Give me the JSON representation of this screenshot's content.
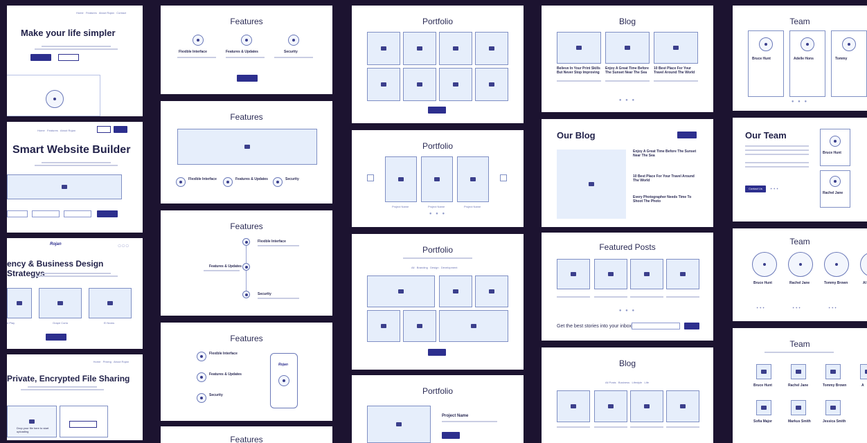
{
  "colors": {
    "background": "#1c1330",
    "card": "#ffffff",
    "accent": "#2d2f8e",
    "placeholder": "#e6eefb"
  },
  "hero": {
    "t1": "Make your life simpler",
    "t2": "Smart Website Builder",
    "t3": "ency & Business Design Strategys",
    "t4": "Private, Encrypted File Sharing",
    "logo": "Rojan",
    "c3_labels": [
      "n Play",
      "Grape Corla",
      "El Noms"
    ],
    "upload_text": "Drop your file here to start uploading"
  },
  "features": {
    "title": "Features",
    "items": [
      "Flexible Interface",
      "Features & Updates",
      "Security"
    ],
    "phone_logo": "Rojan"
  },
  "portfolio": {
    "title": "Portfolio",
    "project_name": "Project Name",
    "project_label": "Project Name"
  },
  "blog": {
    "title": "Blog",
    "our_blog": "Our Blog",
    "featured": "Featured Posts",
    "subscribe": "Get the best stories into your inbox",
    "posts": [
      "Believe In Your Print Skills But Never Stop Improving",
      "Enjoy A Great Time Before The Sunset Near The Sea",
      "10 Best Place For Your Travel Around The World"
    ],
    "side_posts": [
      "Enjoy A Great Time Before The Sunset Near The Sea",
      "10 Best Place For Your Travel Around The World",
      "Every Photographer Needs Time To Shoot The Photo"
    ]
  },
  "team": {
    "title": "Team",
    "our_team": "Our Team",
    "members": [
      "Bruce Hunt",
      "Adelle Hons",
      "Tommy"
    ],
    "row3": [
      "Bruce Hunt",
      "Rachel Jane",
      "Tommy Brown",
      "Al"
    ],
    "row4a": [
      "Bruce Hunt",
      "Rachel Jane",
      "Tommy Brown",
      "A"
    ],
    "row4b": [
      "Sofia Major",
      "Markus Smith",
      "Jessica Smith"
    ],
    "contact": "Contact Us",
    "card_names": [
      "Bruce Hunt",
      "Rachel Jane"
    ]
  }
}
